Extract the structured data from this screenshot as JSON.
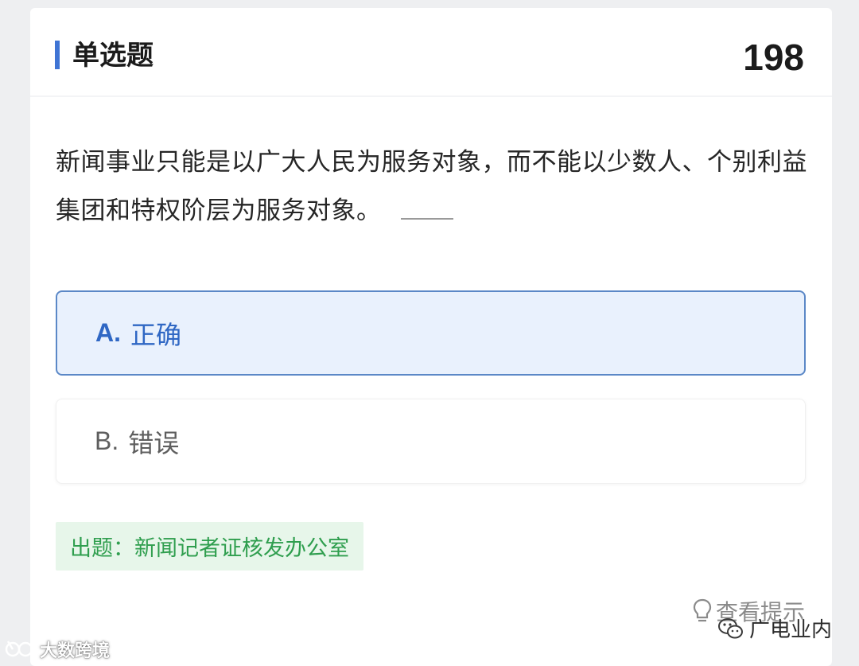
{
  "header": {
    "question_type": "单选题",
    "question_number": "198"
  },
  "question": {
    "text": "新闻事业只能是以广大人民为服务对象，而不能以少数人、个别利益集团和特权阶层为服务对象。"
  },
  "options": [
    {
      "key": "A.",
      "label": "正确",
      "selected": true
    },
    {
      "key": "B.",
      "label": "错误",
      "selected": false
    }
  ],
  "source": {
    "text": "出题：新闻记者证核发办公室"
  },
  "hint": {
    "label": "查看提示",
    "icon": "lightbulb-icon"
  },
  "watermarks": {
    "left": {
      "text": "大数跨境",
      "icon": "logo-icon"
    },
    "right": {
      "text": "广电业内",
      "icon": "wechat-icon"
    }
  },
  "colors": {
    "accent": "#3f74d4",
    "selected_bg": "#e9f1fd",
    "selected_border": "#5b88c7",
    "source_bg": "#e7f6ea",
    "source_text": "#2f9e4e"
  }
}
